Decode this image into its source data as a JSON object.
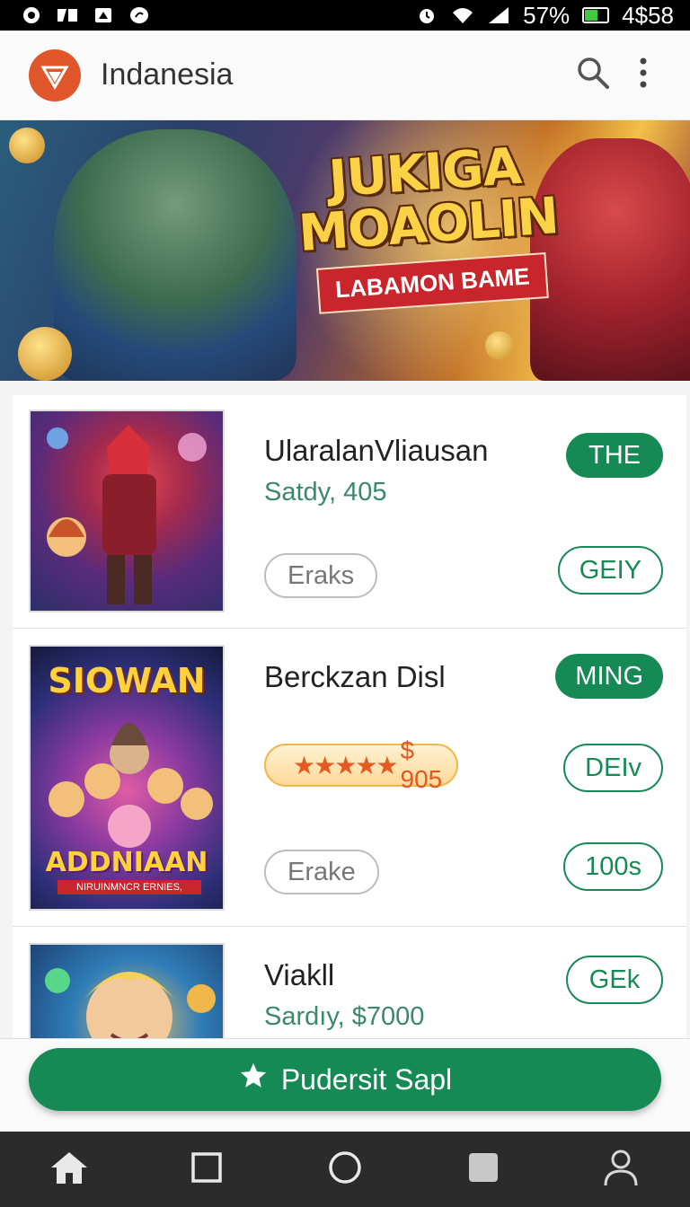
{
  "status_bar": {
    "battery_text": "57%",
    "battery_level": 0.57,
    "time": "4$58",
    "left_icons": [
      "app-icon-1",
      "app-icon-2",
      "app-icon-3",
      "app-icon-4"
    ],
    "right_icons": [
      "alarm-icon",
      "wifi-icon",
      "signal-icon",
      "battery-icon"
    ]
  },
  "app_bar": {
    "title": "Indanesia",
    "logo_icon": "brand-logo-icon",
    "actions": [
      "search-icon",
      "more-vert-icon"
    ]
  },
  "banner": {
    "title_line1": "JUKIGA",
    "title_line2": "MOAOLIN",
    "ribbon": "LABAMON BAME"
  },
  "items": [
    {
      "title": "UlaralanVliausan",
      "subtitle": "Satdy, 405",
      "tag": "Eraks",
      "badge": "THE",
      "action": "GEIY"
    },
    {
      "title": "Berckzan Disl",
      "thumb_title": "SIOWAN",
      "thumb_bottom": "ADDNIAAN",
      "thumb_sub": "NIRUINMNCR ERNIES,",
      "rating_text": "$ 905",
      "stars": 4.5,
      "tag": "Erake",
      "badge": "MING",
      "action": "DEIv",
      "secondary_action": "100s"
    },
    {
      "title": "Viakll",
      "subtitle": "Sardıy, $7000",
      "action": "GEk"
    }
  ],
  "primary_button": {
    "label": "Pudersit Sapl",
    "icon": "star-icon"
  },
  "bottom_nav": [
    "home-icon",
    "square-icon",
    "circle-icon",
    "filled-square-icon",
    "person-icon"
  ],
  "colors": {
    "accent": "#158a55",
    "brand": "#e0562a",
    "status_bg": "#000000",
    "nav_bg": "#2b2b2b"
  }
}
